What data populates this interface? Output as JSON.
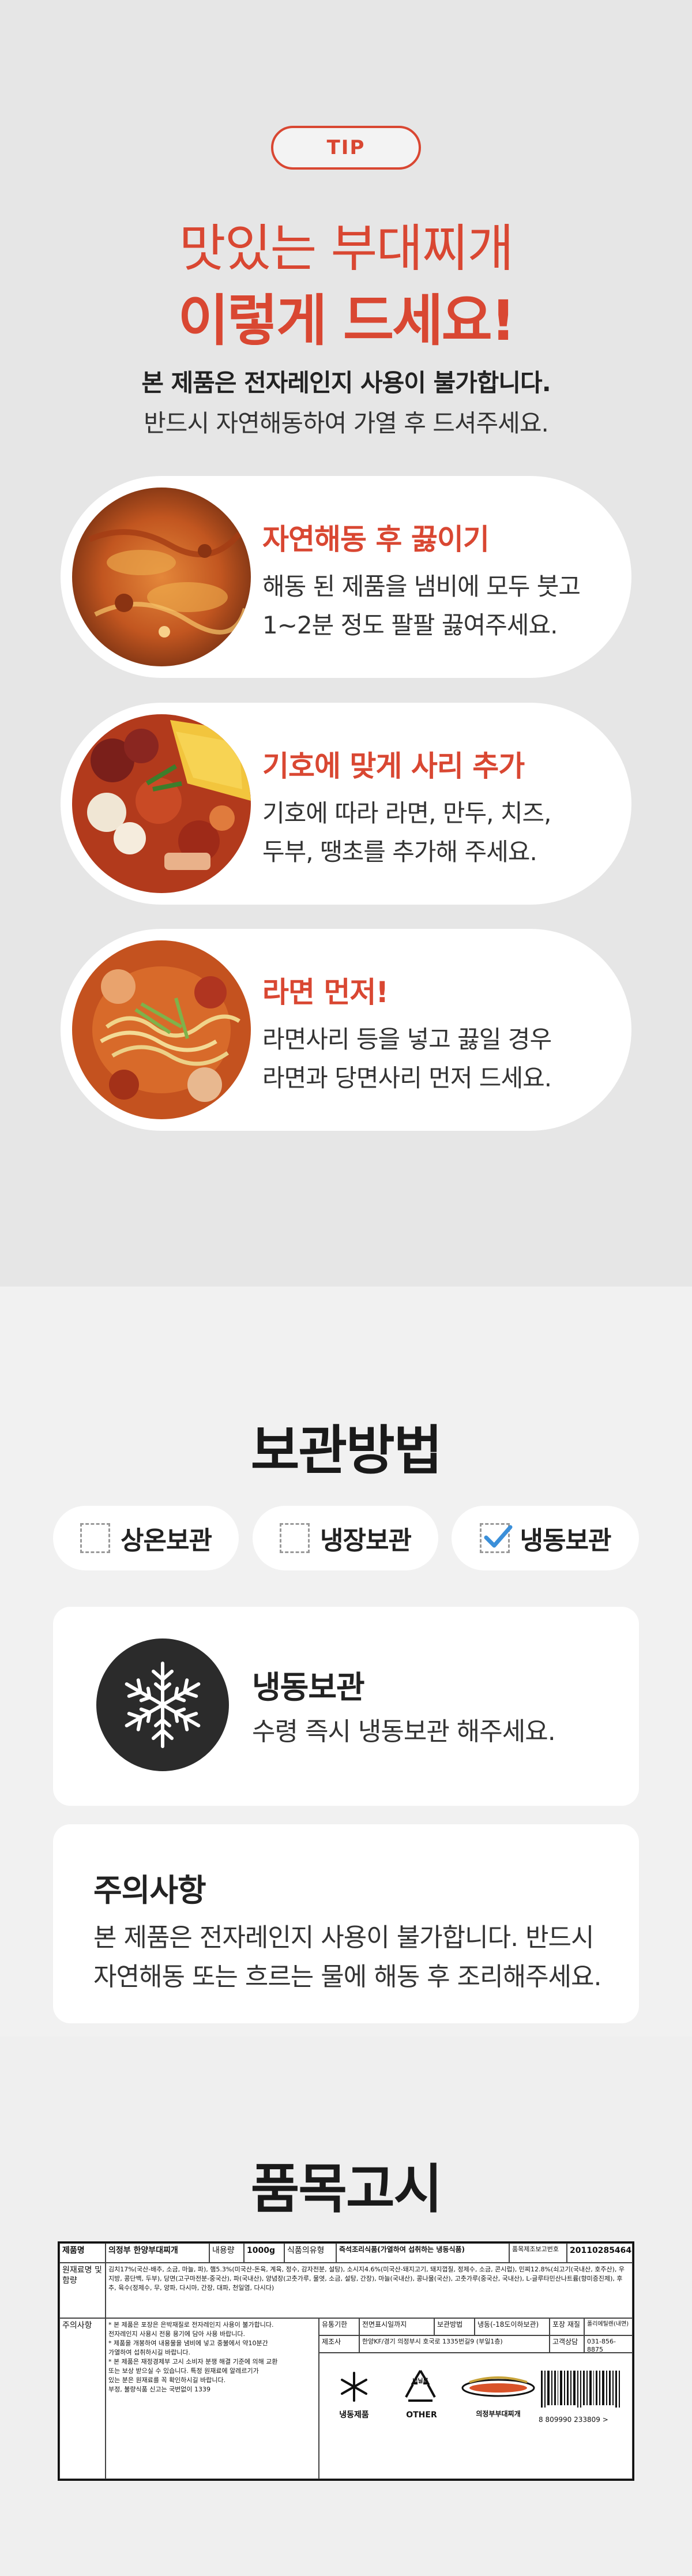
{
  "tip": {
    "badge": "TIP",
    "headline_1": "맛있는 부대찌개",
    "headline_2": "이렇게 드세요!",
    "sub_1": "본 제품은 전자레인지 사용이 불가합니다.",
    "sub_2": "반드시 자연해동하여 가열 후 드셔주세요.",
    "steps": [
      {
        "title": "자연해동 후 끓이기",
        "line_1": "해동 된 제품을 냄비에 모두 붓고",
        "line_2": "1~2분 정도 팔팔 끓여주세요."
      },
      {
        "title": "기호에 맞게 사리 추가",
        "line_1": "기호에 따라 라면, 만두, 치즈,",
        "line_2": "두부, 땡초를 추가해 주세요."
      },
      {
        "title": "라면 먼저!",
        "line_1": "라면사리 등을 넣고 끓일 경우",
        "line_2": "라면과 당면사리 먼저 드세요."
      }
    ]
  },
  "storage": {
    "title": "보관방법",
    "options": [
      {
        "label": "상온보관",
        "checked": false
      },
      {
        "label": "냉장보관",
        "checked": false
      },
      {
        "label": "냉동보관",
        "checked": true
      }
    ],
    "check_color": "#3b8fd9",
    "freeze_title": "냉동보관",
    "freeze_desc": "수령 즉시 냉동보관 해주세요.",
    "caution_title": "주의사항",
    "caution_line_1": "본 제품은 전자레인지 사용이 불가합니다. 반드시",
    "caution_line_2": "자연해동 또는 흐르는 물에 해동 후 조리해주세요."
  },
  "label": {
    "title": "품목고시",
    "r1": {
      "k_name": "제품명",
      "v_name": "의정부 한양부대찌개",
      "k_weight": "내용량",
      "v_weight": "1000g",
      "k_type": "식품의유형",
      "v_type": "즉석조리식품(가열하여 섭취하는 냉동식품)",
      "k_report": "품목제조보고번호",
      "v_report": "201102854643"
    },
    "r2": {
      "k": "원재료명 및 함량",
      "v": "김치17%(국산-배추, 소금, 마늘, 파), 햄5.3%(미국산-돈육, 계육, 정수, 감자전분, 설탕), 소시지4.6%(미국산-돼지고기, 돼지껍질, 정제수, 소금, 콘시럽), 민찌12.8%(쇠고기(국내산, 호주산), 우지방, 콩단백, 두부), 당면(고구마전분-중국산), 파(국내산), 양념장(고춧가루, 물엿, 소금, 설탕, 간장), 마늘(국내산), 콩나물(국산), 고춧가루(중국산, 국내산), L-글루타민산나트륨(향미증진제), 후추, 육수(정제수, 무, 양파, 다시마, 간장, 대파, 천일염, 다시다)"
    },
    "r3": {
      "k": "주의사항",
      "items": [
        "* 본 제품은 포장은 은박재질로 전자레인지 사용이 불가합니다.",
        "  전자레인지 사용시 전용 용기에 담아 사용 바랍니다.",
        "* 제품을 개봉하여 내용물을 냄비에 넣고 중불에서 약10분간",
        "  가열하여 섭취하시길 바랍니다.",
        "* 본 제품은 재정경제부 고시 소비자 분쟁 해결 기준에 의해 교환",
        "  또는 보상 받으실 수 있습니다. 특정 원재료에 알레르기가",
        "  있는 분은 원재료를 꼭 확인하시길 바랍니다.",
        "  부정, 불량식품 신고는 국번없이 1339"
      ],
      "k_expiry": "유통기한",
      "v_expiry": "전면표시일까지",
      "k_storage": "보관방법",
      "v_storage": "냉동(-18도이하보관)",
      "k_pack": "포장 재질",
      "v_pack": "폴리에틸렌(내면)",
      "k_maker": "제조사",
      "v_maker": "한양KF/경기 의정부시 호국로 1335번길9 (부일1층)",
      "k_cs": "고객상담",
      "v_cs": "031-856-8875"
    },
    "icons": {
      "frozen": "냉동제품",
      "recycle_top": "비닐류",
      "recycle": "OTHER",
      "brand": "의정부부대찌개"
    },
    "barcode_number": "8  809990  233809  >"
  }
}
